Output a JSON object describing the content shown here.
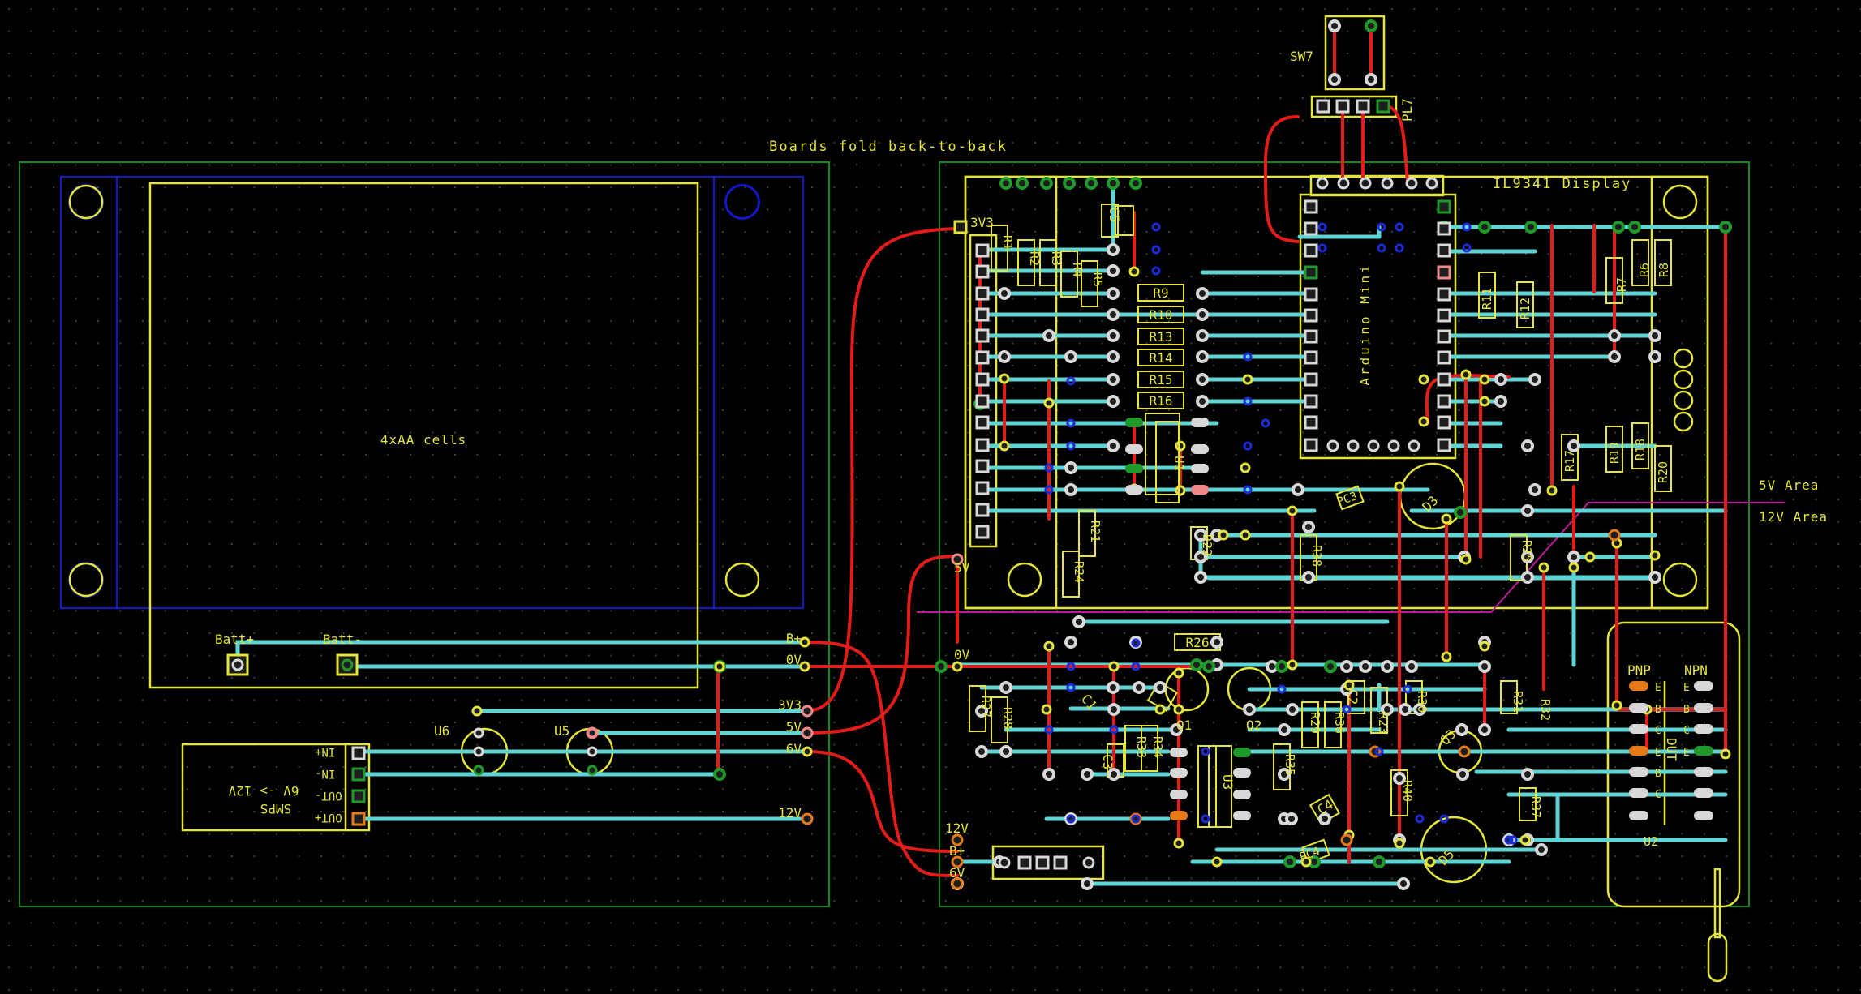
{
  "labels": {
    "fold_note": "Boards fold back-to-back",
    "display": "IL9341 Display",
    "battery": "4xAA cells",
    "batt_plus": "Batt+",
    "batt_minus": "Batt-",
    "area_5v": "5V Area",
    "area_12v": "12V Area",
    "arduino": "Arduino Mini",
    "smps_line1": "SMPS",
    "smps_line2": "6V -> 12V",
    "pnp": "PNP",
    "npn": "NPN",
    "dut": "DUT"
  },
  "smps_pins": [
    "IN+",
    "IN-",
    "OUT-",
    "OUT+"
  ],
  "left_rail": [
    "B+",
    "0V",
    "3V3",
    "5V",
    "6V",
    "12V"
  ],
  "right_rail": {
    "v33": "3V3",
    "v5": "5V",
    "v0": "0V",
    "v12": "12V",
    "bplus": "B+",
    "v6": "6V"
  },
  "refs": {
    "sw7": "SW7",
    "pl7": "PL7",
    "u1": "U1",
    "u2": "U2",
    "u3": "U3",
    "u5": "U5",
    "u6": "U6",
    "q1": "Q1",
    "q2": "Q2",
    "q3": "Q3",
    "d3": "D3",
    "d5": "D5",
    "c1": "C1",
    "c2": "C2",
    "c3": "C3",
    "c4": "C4",
    "c5": "C5",
    "pc3": "PC3",
    "pc4": "PC4"
  },
  "resistors_h": [
    "R9",
    "R10",
    "R13",
    "R14",
    "R15",
    "R16",
    "R26"
  ],
  "resistors_v": [
    "R1",
    "R2",
    "R3",
    "R4",
    "R5",
    "R6",
    "R7",
    "R8",
    "R11",
    "R12",
    "R17",
    "R18",
    "R19",
    "R20",
    "R21",
    "R22",
    "R23",
    "R24",
    "R25",
    "R27",
    "R28",
    "R29",
    "R30",
    "R31",
    "R32",
    "R33",
    "R34",
    "R35",
    "R36",
    "R37",
    "R38",
    "R40"
  ],
  "transistor_pins": [
    "E",
    "B",
    "C",
    "E",
    "B",
    "C"
  ],
  "colors": {
    "background": "#000000",
    "grid_dot": "#3c3c3c",
    "board_outline": "#0c8a22",
    "battery_outline": "#1418c8",
    "silkscreen": "#e4e43a",
    "track_bottom": "#5fd4d4",
    "track_top": "#e21b1b",
    "pad_white": "#d8d8d8",
    "pad_green": "#1f9a2a",
    "pad_orange": "#e67a1a",
    "pad_pink": "#f08a8a",
    "via_blue": "#1c2cd4",
    "area_divider": "#c01a9a"
  }
}
